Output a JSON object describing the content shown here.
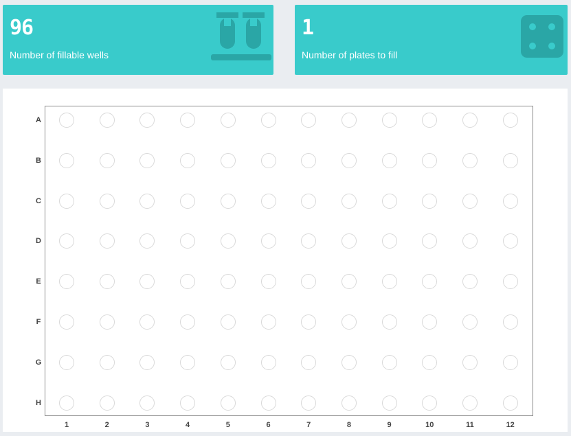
{
  "stats": {
    "wells": {
      "value": "96",
      "label": "Number of fillable wells",
      "icon": "test-tubes-icon"
    },
    "plates": {
      "value": "1",
      "label": "Number of plates to fill",
      "icon": "dice-four-icon"
    }
  },
  "colors": {
    "card_background": "#39cbcb",
    "card_icon": "#2aa6a6",
    "well_border": "#d9d9d9",
    "plate_border": "#8a8a8a",
    "page_background": "#eaedf1"
  },
  "plate": {
    "rows": [
      "A",
      "B",
      "C",
      "D",
      "E",
      "F",
      "G",
      "H"
    ],
    "columns": [
      "1",
      "2",
      "3",
      "4",
      "5",
      "6",
      "7",
      "8",
      "9",
      "10",
      "11",
      "12"
    ]
  }
}
